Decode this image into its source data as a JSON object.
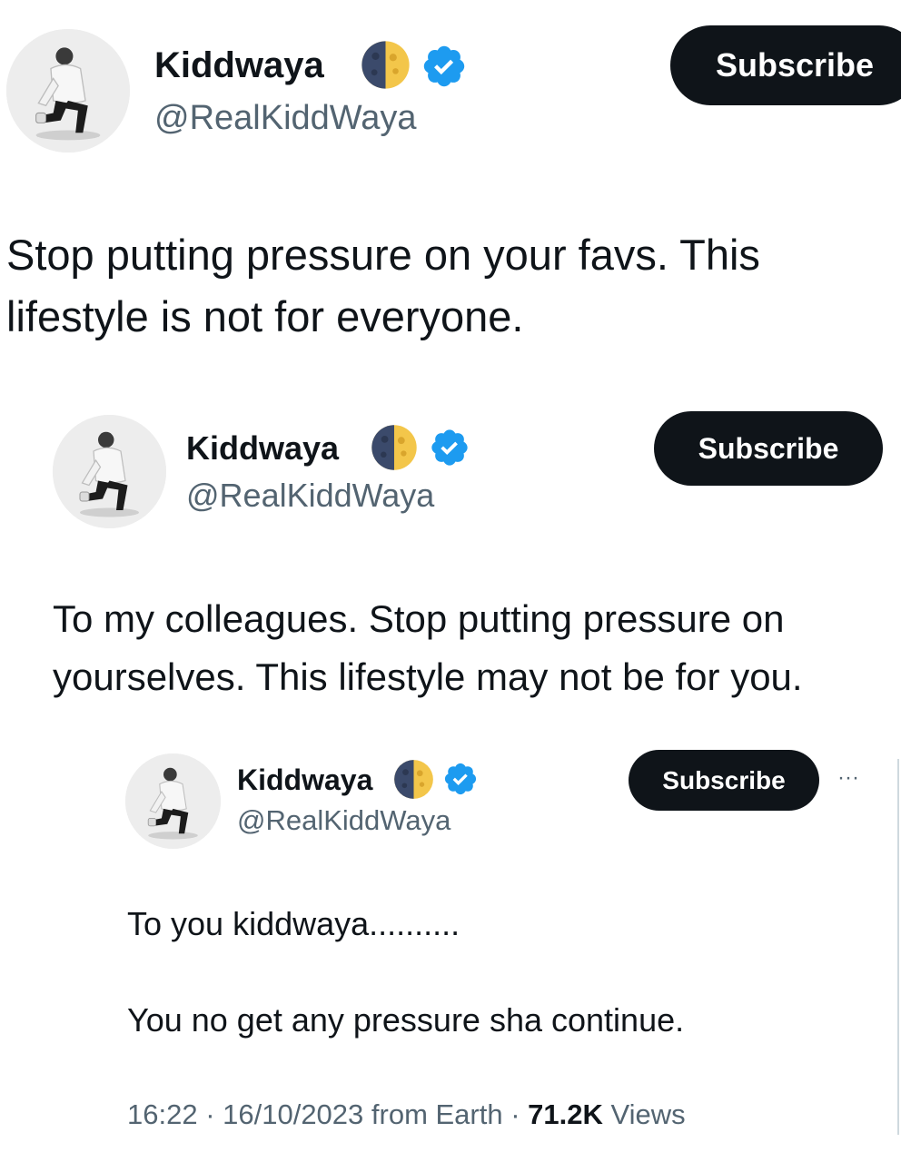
{
  "colors": {
    "text": "#0f1419",
    "muted": "#536471",
    "button_bg": "#0f1419",
    "verified": "#1d9bf0"
  },
  "icons": [
    "avatar-photo",
    "moon-emoji-icon",
    "verified-badge-icon",
    "more-icon"
  ],
  "tweet1": {
    "name": "Kiddwaya",
    "handle": "@RealKiddWaya",
    "subscribe_label": "Subscribe",
    "text_line1": "Stop putting pressure on your favs. This",
    "text_line2": "lifestyle is not for everyone."
  },
  "tweet2": {
    "name": "Kiddwaya",
    "handle": "@RealKiddWaya",
    "subscribe_label": "Subscribe",
    "text_line1": "To my colleagues. Stop putting pressure on",
    "text_line2": "yourselves. This lifestyle may not be for you."
  },
  "tweet3": {
    "name": "Kiddwaya",
    "handle": "@RealKiddWaya",
    "subscribe_label": "Subscribe",
    "more_label": "···",
    "text_line1": "To you kiddwaya..........",
    "text_line2": "You no get any pressure sha continue.",
    "meta_time": "16:22 · 16/10/2023 from Earth · ",
    "meta_views_count": "71.2K",
    "meta_views_label": " Views"
  }
}
